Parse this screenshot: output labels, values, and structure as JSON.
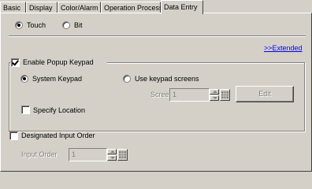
{
  "tabs": [
    {
      "label": "Basic",
      "active": false
    },
    {
      "label": "Display",
      "active": false
    },
    {
      "label": "Color/Alarm",
      "active": false
    },
    {
      "label": "Operation Process",
      "active": false
    },
    {
      "label": "Data Entry",
      "active": true
    }
  ],
  "input_type": {
    "touch_label": "Touch",
    "bit_label": "Bit",
    "selected": "Touch"
  },
  "extended_link": ">>Extended",
  "popup_keypad": {
    "enable_label": "Enable Popup Keypad",
    "enabled": true,
    "system_keypad_label": "System Keypad",
    "use_screens_label": "Use keypad screens",
    "selected": "System Keypad",
    "screen_label": "Screen",
    "screen_value": "1",
    "edit_label": "Edit",
    "specify_location_label": "Specify Location",
    "specify_location_checked": false
  },
  "designated_order": {
    "label": "Designated Input Order",
    "checked": false,
    "input_order_label": "Input Order",
    "input_order_value": "1"
  },
  "colors": {
    "face": "#d4d0c8",
    "link": "#0000ff",
    "disabled_text": "#808080"
  }
}
